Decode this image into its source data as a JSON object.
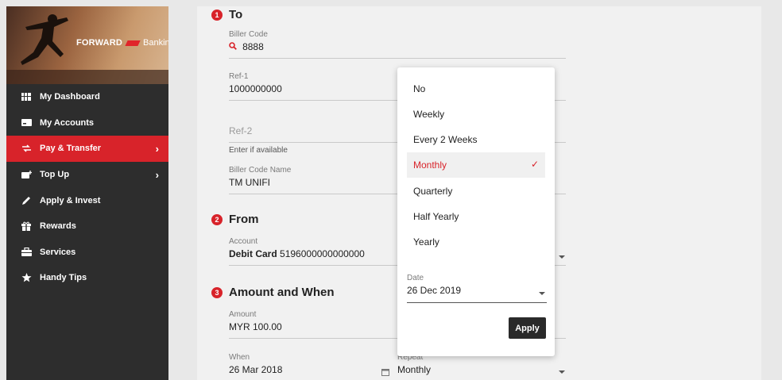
{
  "brand": {
    "name": "FORWARD",
    "suffix": "Banking"
  },
  "sidebar": {
    "items": [
      {
        "label": "My Dashboard",
        "icon": "dashboard-icon"
      },
      {
        "label": "My Accounts",
        "icon": "card-icon"
      },
      {
        "label": "Pay & Transfer",
        "icon": "transfer-icon",
        "active": true,
        "chevron": "›"
      },
      {
        "label": "Top Up",
        "icon": "topup-icon",
        "chevron": "›"
      },
      {
        "label": "Apply & Invest",
        "icon": "pen-icon"
      },
      {
        "label": "Rewards",
        "icon": "gift-icon"
      },
      {
        "label": "Services",
        "icon": "briefcase-icon"
      },
      {
        "label": "Handy Tips",
        "icon": "star-icon"
      }
    ]
  },
  "form": {
    "to": {
      "number": "1",
      "title": "To"
    },
    "biller_code": {
      "label": "Biller Code",
      "value": "8888"
    },
    "ref1": {
      "label": "Ref-1",
      "value": "1000000000"
    },
    "ref2": {
      "placeholder": "Ref-2",
      "hint": "Enter if available"
    },
    "biller_name": {
      "label": "Biller Code Name",
      "value": "TM UNIFI"
    },
    "from": {
      "number": "2",
      "title": "From"
    },
    "account": {
      "label": "Account",
      "type": "Debit Card",
      "number": "5196000000000000"
    },
    "amount_when": {
      "number": "3",
      "title": "Amount and When"
    },
    "amount": {
      "label": "Amount",
      "value": "MYR 100.00"
    },
    "when": {
      "label": "When",
      "value": "26 Mar 2018"
    },
    "repeat": {
      "label": "Repeat",
      "value": "Monthly"
    }
  },
  "repeat_dropdown": {
    "options": [
      "No",
      "Weekly",
      "Every 2 Weeks",
      "Monthly",
      "Quarterly",
      "Half Yearly",
      "Yearly"
    ],
    "selected": "Monthly",
    "check": "✓",
    "date": {
      "label": "Date",
      "value": "26 Dec 2019"
    },
    "apply_label": "Apply"
  },
  "colors": {
    "accent": "#d8232a",
    "sidebar_bg": "#2d2d2d",
    "main_bg": "#f1f1f1"
  }
}
